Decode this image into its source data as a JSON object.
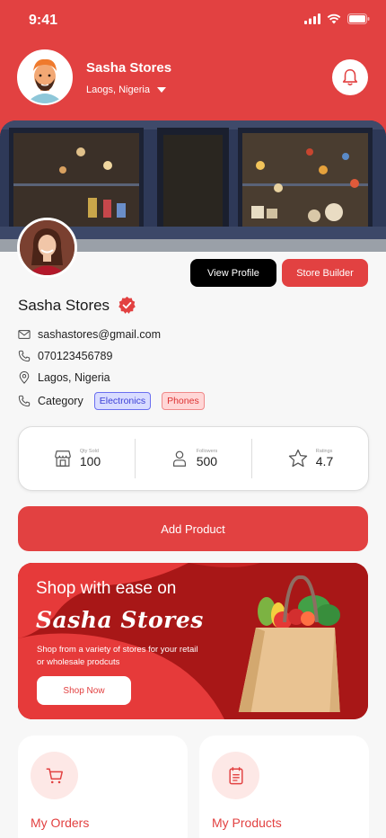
{
  "status_bar": {
    "time": "9:41"
  },
  "header": {
    "store_name": "Sasha Stores",
    "location": "Laogs, Nigeria",
    "colors": {
      "primary": "#e24141"
    }
  },
  "profile": {
    "view_profile_label": "View Profile",
    "store_builder_label": "Store Builder",
    "store_name": "Sasha Stores",
    "email": "sashastores@gmail.com",
    "phone": "070123456789",
    "address": "Lagos, Nigeria",
    "category_label": "Category",
    "categories": [
      "Electronics",
      "Phones"
    ]
  },
  "stats": [
    {
      "label": "Qty Sold",
      "value": "100",
      "icon": "store-icon"
    },
    {
      "label": "Followers",
      "value": "500",
      "icon": "user-icon"
    },
    {
      "label": "Ratings",
      "value": "4.7",
      "icon": "star-icon"
    }
  ],
  "add_product_label": "Add Product",
  "promo": {
    "heading": "Shop with ease on",
    "brand": "Sasha Stores",
    "description": "Shop from a variety of stores for your retail or wholesale prodcuts",
    "button_label": "Shop Now"
  },
  "cards": [
    {
      "label": "My Orders",
      "icon": "cart-icon"
    },
    {
      "label": "My Products",
      "icon": "clipboard-icon"
    }
  ]
}
